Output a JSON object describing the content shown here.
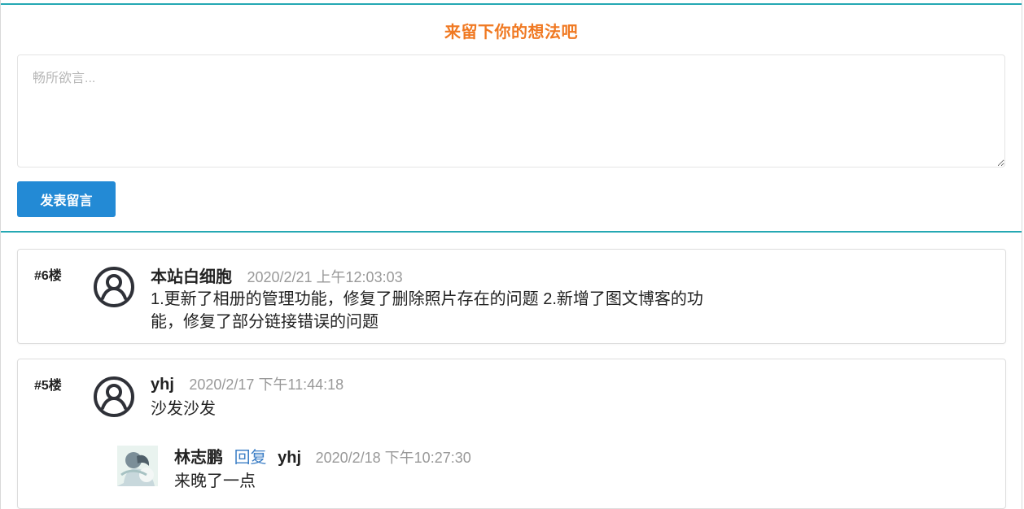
{
  "form": {
    "title": "来留下你的想法吧",
    "placeholder": "畅所欲言...",
    "value": "",
    "submit_label": "发表留言"
  },
  "comments": [
    {
      "floor": "#6楼",
      "avatar_icon": "user-circle-icon",
      "author": "本站白细胞",
      "time": "2020/2/21 上午12:03:03",
      "content": "1.更新了相册的管理功能，修复了删除照片存在的问题 2.新增了图文博客的功能，修复了部分链接错误的问题"
    },
    {
      "floor": "#5楼",
      "avatar_icon": "user-circle-icon",
      "author": "yhj",
      "time": "2020/2/17 下午11:44:18",
      "content": "沙发沙发",
      "reply": {
        "avatar_icon": "profile-photo-icon",
        "author": "林志鹏",
        "action": "回复",
        "target": "yhj",
        "time": "2020/2/18 下午10:27:30",
        "content": "来晚了一点"
      }
    }
  ],
  "colors": {
    "accent_teal": "#25a8b3",
    "title_orange": "#f07922",
    "button_blue": "#238ad5",
    "reply_link_blue": "#3d7fc6"
  }
}
